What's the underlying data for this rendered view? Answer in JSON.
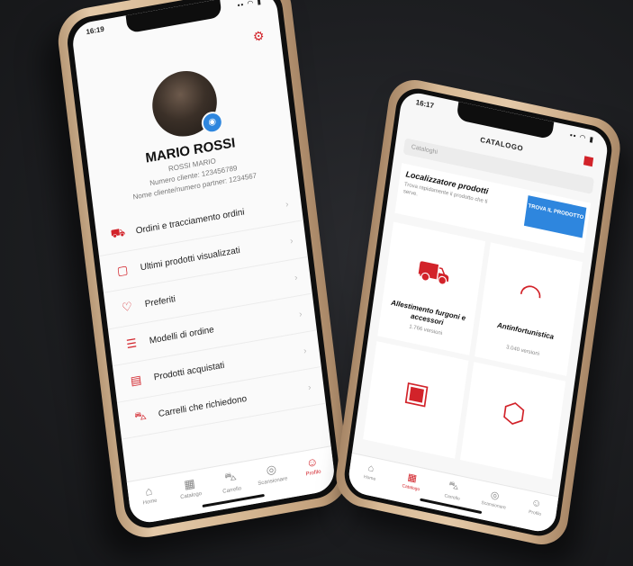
{
  "profile_screen": {
    "status_time": "16:19",
    "status_icons": "▪▪ ◠ ▮",
    "user_name": "MARIO ROSSI",
    "user_full": "ROSSI MARIO",
    "customer_number": "Numero cliente: 123456789",
    "partner_number": "Nome cliente/numero partner: 1234567",
    "menu": [
      {
        "label": "Ordini e tracciamento ordini",
        "icon": "truck-icon"
      },
      {
        "label": "Ultimi prodotti visualizzati",
        "icon": "box-icon"
      },
      {
        "label": "Preferiti",
        "icon": "heart-icon"
      },
      {
        "label": "Modelli di ordine",
        "icon": "clipboard-icon"
      },
      {
        "label": "Prodotti acquistati",
        "icon": "receipt-icon"
      },
      {
        "label": "Carrelli che richiedono",
        "icon": "cart-icon"
      }
    ],
    "tabs": [
      {
        "label": "Home",
        "icon": "home-icon"
      },
      {
        "label": "Catalogo",
        "icon": "catalog-icon"
      },
      {
        "label": "Carrello",
        "icon": "cart-icon"
      },
      {
        "label": "Scansionare",
        "icon": "scan-icon"
      },
      {
        "label": "Profilo",
        "icon": "profile-icon"
      }
    ]
  },
  "catalog_screen": {
    "status_time": "16:17",
    "title": "CATALOGO",
    "search_placeholder": "Cataloghi",
    "finder_title": "Localizzatore prodotti",
    "finder_desc": "Trova rapidamente il prodotto che ti serve.",
    "finder_button": "TROVA IL PRODOTTO",
    "categories": [
      {
        "name": "Allestimento furgoni e accessori",
        "count": "1.766 versioni",
        "icon": "van-icon"
      },
      {
        "name": "Antinfortunistica",
        "count": "3.040 versioni",
        "icon": "headphones-icon"
      },
      {
        "name": "",
        "count": "",
        "icon": "toolbox-icon"
      },
      {
        "name": "",
        "count": "",
        "icon": "nut-icon"
      }
    ],
    "tabs": [
      {
        "label": "Home",
        "icon": "home-icon"
      },
      {
        "label": "Catalogo",
        "icon": "catalog-icon"
      },
      {
        "label": "Carrello",
        "icon": "cart-icon"
      },
      {
        "label": "Scansionare",
        "icon": "scan-icon"
      },
      {
        "label": "Profilo",
        "icon": "profile-icon"
      }
    ]
  },
  "colors": {
    "accent": "#d2232a",
    "button_blue": "#2e86de",
    "frame_gold": "#d7b995"
  }
}
